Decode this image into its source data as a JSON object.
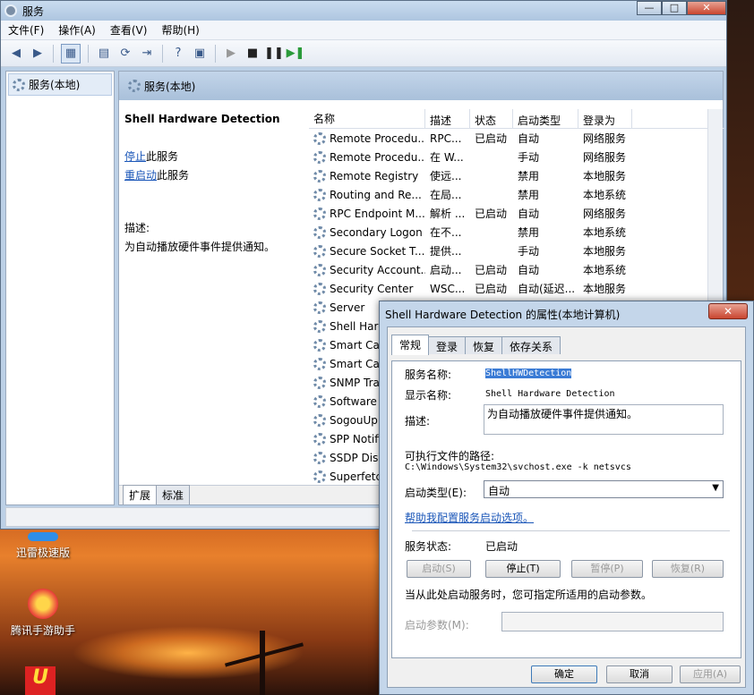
{
  "window": {
    "title": "服务",
    "minimize": "—",
    "maximize": "□",
    "close": "✕"
  },
  "menu": [
    "文件(F)",
    "操作(A)",
    "查看(V)",
    "帮助(H)"
  ],
  "tree": {
    "item": "服务(本地)"
  },
  "content_header": "服务(本地)",
  "desc": {
    "service_title": "Shell Hardware Detection",
    "stop_link": "停止",
    "stop_suffix": "此服务",
    "restart_link": "重启动",
    "restart_suffix": "此服务",
    "desc_label": "描述:",
    "desc_text": "为自动播放硬件事件提供通知。"
  },
  "list": {
    "columns": [
      "名称",
      "描述",
      "状态",
      "启动类型",
      "登录为"
    ],
    "rows": [
      [
        "Remote Procedu...",
        "RPC...",
        "已启动",
        "自动",
        "网络服务"
      ],
      [
        "Remote Procedu...",
        "在 W...",
        "",
        "手动",
        "网络服务"
      ],
      [
        "Remote Registry",
        "使远...",
        "",
        "禁用",
        "本地服务"
      ],
      [
        "Routing and Re...",
        "在局...",
        "",
        "禁用",
        "本地系统"
      ],
      [
        "RPC Endpoint M...",
        "解析 ...",
        "已启动",
        "自动",
        "网络服务"
      ],
      [
        "Secondary Logon",
        "在不...",
        "",
        "禁用",
        "本地系统"
      ],
      [
        "Secure Socket T...",
        "提供...",
        "",
        "手动",
        "本地服务"
      ],
      [
        "Security Account...",
        "启动...",
        "已启动",
        "自动",
        "本地系统"
      ],
      [
        "Security Center",
        "WSC...",
        "已启动",
        "自动(延迟...",
        "本地服务"
      ],
      [
        "Server",
        "",
        "",
        "",
        ""
      ],
      [
        "Shell Hard",
        "",
        "",
        "",
        ""
      ],
      [
        "Smart Car",
        "",
        "",
        "",
        ""
      ],
      [
        "Smart Car",
        "",
        "",
        "",
        ""
      ],
      [
        "SNMP Tra",
        "",
        "",
        "",
        ""
      ],
      [
        "Software",
        "",
        "",
        "",
        ""
      ],
      [
        "SogouUp",
        "",
        "",
        "",
        ""
      ],
      [
        "SPP Notifi",
        "",
        "",
        "",
        ""
      ],
      [
        "SSDP Disc",
        "",
        "",
        "",
        ""
      ],
      [
        "Superfetc",
        "",
        "",
        "",
        ""
      ]
    ]
  },
  "bottom_tabs": [
    "扩展",
    "标准"
  ],
  "desktop_icons": [
    "迅雷极速版",
    "腾讯手游助手"
  ],
  "dialog": {
    "title": "Shell Hardware Detection 的属性(本地计算机)",
    "close": "✕",
    "tabs": [
      "常规",
      "登录",
      "恢复",
      "依存关系"
    ],
    "service_name_label": "服务名称:",
    "service_name": "ShellHWDetection",
    "display_name_label": "显示名称:",
    "display_name": "Shell Hardware Detection",
    "description_label": "描述:",
    "description": "为自动播放硬件事件提供通知。",
    "path_label": "可执行文件的路径:",
    "path": "C:\\Windows\\System32\\svchost.exe -k netsvcs",
    "startup_label": "启动类型(E):",
    "startup_value": "自动",
    "help_link": "帮助我配置服务启动选项。",
    "status_label": "服务状态:",
    "status_value": "已启动",
    "btn_start": "启动(S)",
    "btn_stop": "停止(T)",
    "btn_pause": "暂停(P)",
    "btn_resume": "恢复(R)",
    "hint": "当从此处启动服务时，您可指定所适用的启动参数。",
    "params_label": "启动参数(M):",
    "ok": "确定",
    "cancel": "取消",
    "apply": "应用(A)"
  }
}
